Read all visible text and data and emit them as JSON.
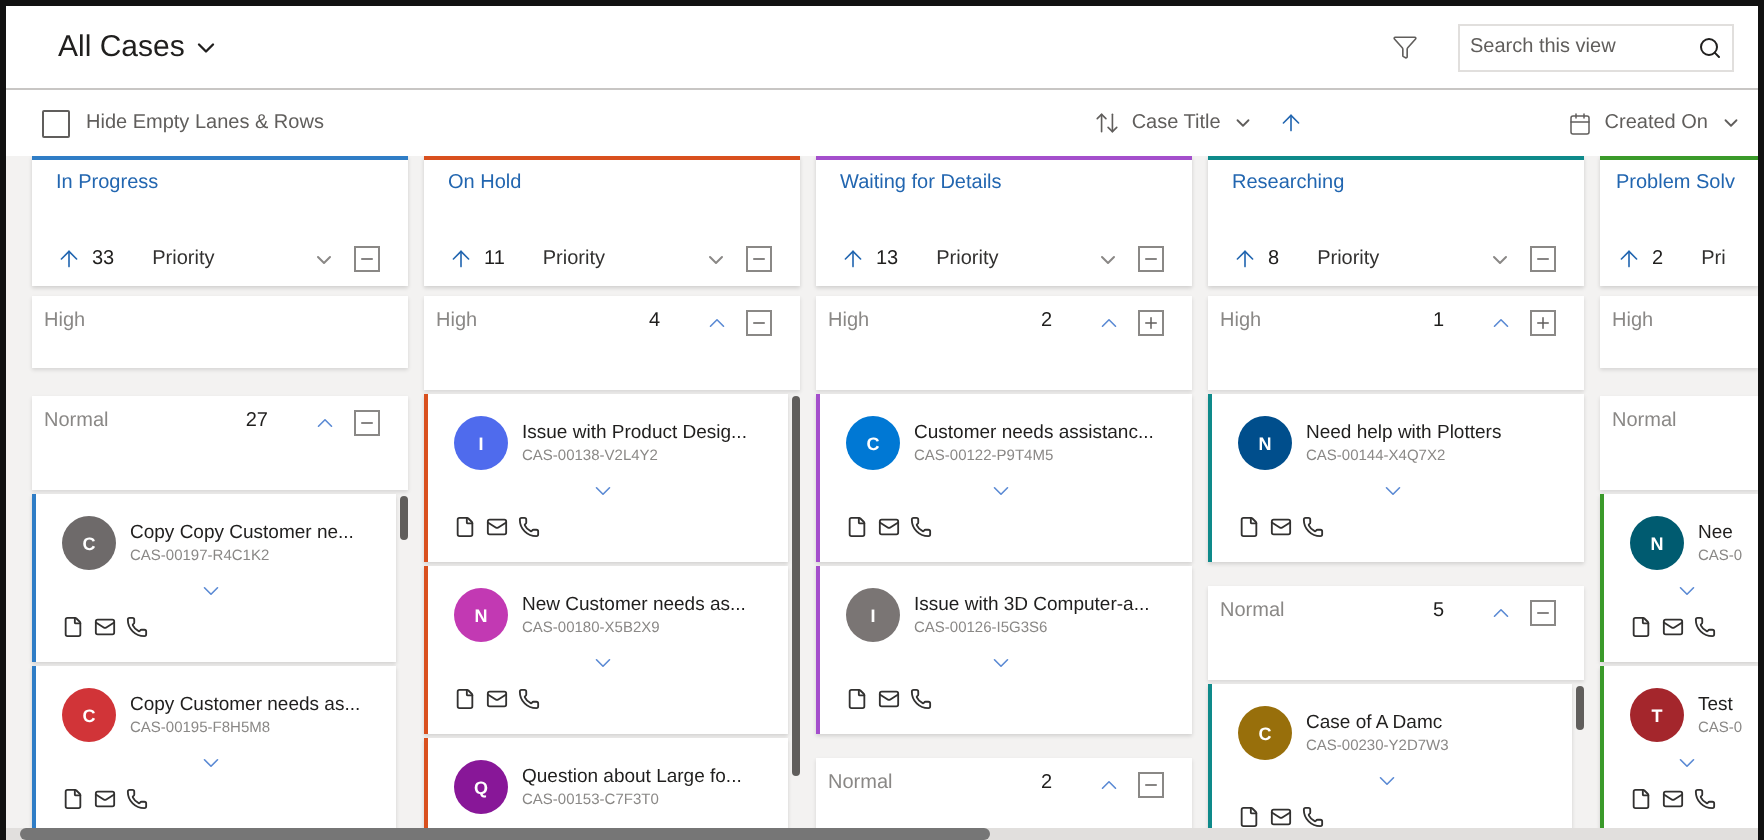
{
  "header": {
    "title": "All Cases",
    "search": {
      "placeholder": "Search this view"
    }
  },
  "toolbar": {
    "hide_empty": {
      "label": "Hide Empty Lanes & Rows",
      "checked": false
    },
    "sort_field": "Case Title",
    "date_field": "Created On"
  },
  "lanes": [
    {
      "title": "In Progress",
      "color": "#2f7dc6",
      "count": "33",
      "group_by": "Priority",
      "menu": true,
      "groups": [
        {
          "label": "High"
        },
        {
          "label": "Normal",
          "count": "27",
          "expanded": true,
          "scrollbar": true,
          "cards": [
            {
              "letter": "C",
              "color": "#6e6a6a",
              "title": "Copy Copy Customer ne...",
              "case_id": "CAS-00197-R4C1K2"
            },
            {
              "letter": "C",
              "color": "#d13438",
              "title": "Copy Customer needs as...",
              "case_id": "CAS-00195-F8H5M8"
            }
          ]
        }
      ]
    },
    {
      "title": "On Hold",
      "color": "#d9501e",
      "count": "11",
      "group_by": "Priority",
      "menu": true,
      "groups": [
        {
          "label": "High",
          "count": "4",
          "expanded": true,
          "scrollbar": true,
          "cards": [
            {
              "letter": "I",
              "color": "#4f6bed",
              "title": "Issue with Product Desig...",
              "case_id": "CAS-00138-V2L4Y2"
            },
            {
              "letter": "N",
              "color": "#c239b3",
              "title": "New Customer needs as...",
              "case_id": "CAS-00180-X5B2X9"
            },
            {
              "letter": "Q",
              "color": "#881798",
              "title": "Question about Large fo...",
              "case_id": "CAS-00153-C7F3T0"
            }
          ]
        }
      ]
    },
    {
      "title": "Waiting for Details",
      "color": "#a44fcc",
      "count": "13",
      "group_by": "Priority",
      "menu": true,
      "groups": [
        {
          "label": "High",
          "count": "2",
          "expanded": false,
          "cards": [
            {
              "letter": "C",
              "color": "#0078d4",
              "title": "Customer needs assistanc...",
              "case_id": "CAS-00122-P9T4M5"
            },
            {
              "letter": "I",
              "color": "#7a7574",
              "title": "Issue with 3D Computer-a...",
              "case_id": "CAS-00126-I5G3S6"
            }
          ]
        },
        {
          "label": "Normal",
          "count": "2",
          "expanded": true
        }
      ]
    },
    {
      "title": "Researching",
      "color": "#0e8a8a",
      "count": "8",
      "group_by": "Priority",
      "menu": true,
      "groups": [
        {
          "label": "High",
          "count": "1",
          "expanded": false,
          "cards": [
            {
              "letter": "N",
              "color": "#004e8c",
              "title": "Need help with Plotters",
              "case_id": "CAS-00144-X4Q7X2"
            }
          ]
        },
        {
          "label": "Normal",
          "count": "5",
          "expanded": true,
          "scrollbar": true,
          "cards": [
            {
              "letter": "C",
              "color": "#986f0b",
              "title": "Case of A Damc",
              "case_id": "CAS-00230-Y2D7W3"
            }
          ]
        }
      ]
    },
    {
      "title": "Problem Solv",
      "color": "#3a9a2a",
      "count": "2",
      "group_by": "Pri",
      "groups": [
        {
          "label": "High"
        },
        {
          "label": "Normal",
          "cards": [
            {
              "letter": "N",
              "color": "#005b70",
              "title": "Nee",
              "case_id": "CAS-0"
            },
            {
              "letter": "T",
              "color": "#a4262c",
              "title": "Test",
              "case_id": "CAS-0"
            }
          ]
        }
      ]
    }
  ]
}
